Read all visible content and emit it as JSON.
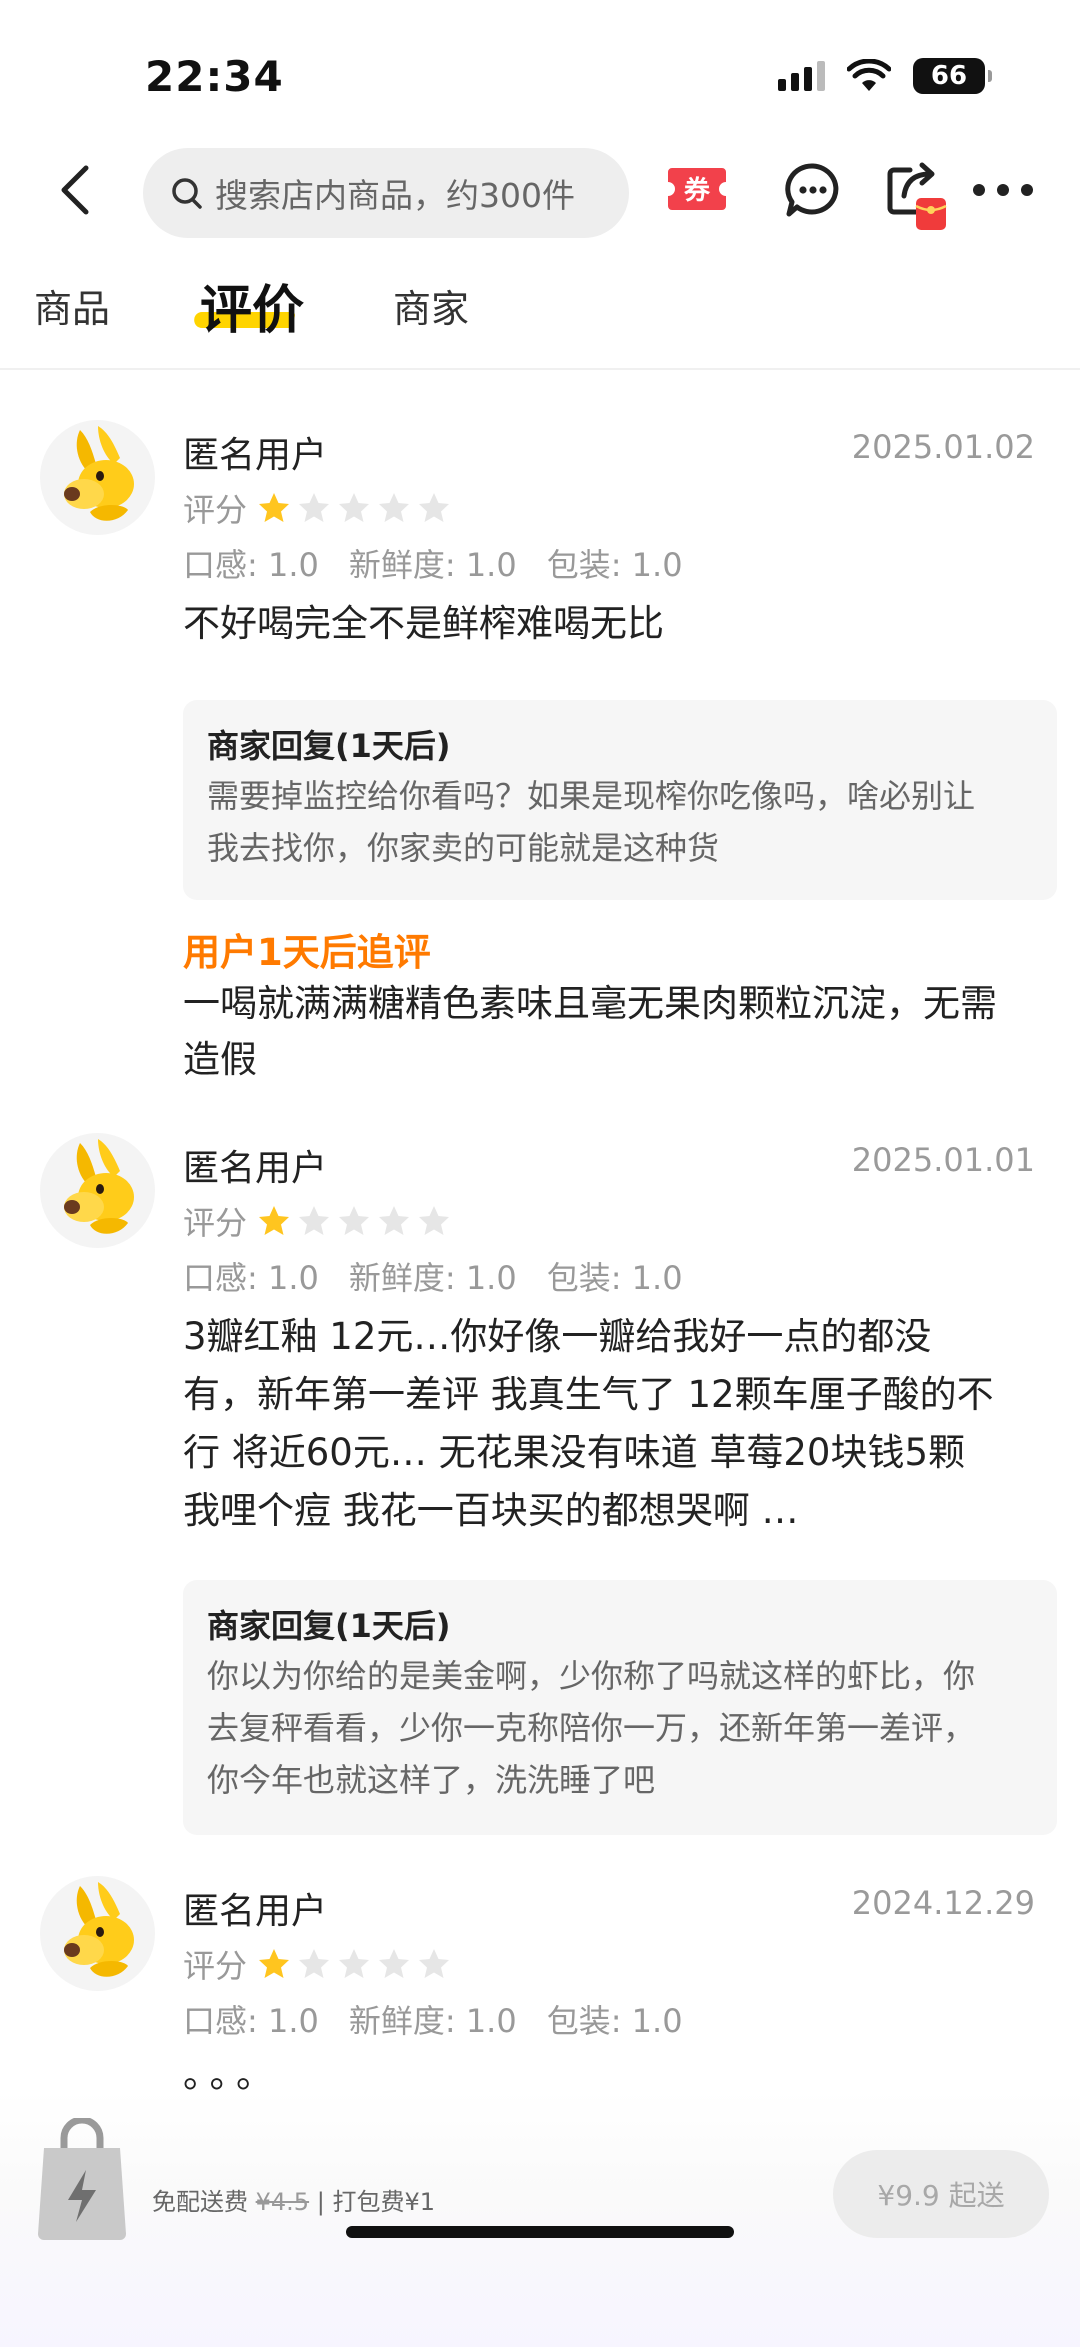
{
  "status_bar": {
    "time": "22:34",
    "battery": "66"
  },
  "header": {
    "search_placeholder": "搜索店内商品，约300件",
    "coupon_label": "券"
  },
  "tabs": [
    {
      "label": "商品",
      "active": false
    },
    {
      "label": "评价",
      "active": true
    },
    {
      "label": "商家",
      "active": false
    }
  ],
  "reviews": [
    {
      "user": "匿名用户",
      "date": "2025.01.02",
      "rating_label": "评分",
      "stars": 1,
      "scores": [
        "口感: 1.0",
        "新鲜度: 1.0",
        "包装: 1.0"
      ],
      "text": "不好喝完全不是鲜榨难喝无比",
      "reply_title": "商家回复(1天后)",
      "reply_lines": [
        "需要掉监控给你看吗？如果是现榨你吃像吗，啥必别让",
        "我去找你，你家卖的可能就是这种货"
      ],
      "followup_label": "用户1天后追评",
      "followup_lines": [
        "一喝就满满糖精色素味且毫无果肉颗粒沉淀，无需",
        "造假"
      ]
    },
    {
      "user": "匿名用户",
      "date": "2025.01.01",
      "rating_label": "评分",
      "stars": 1,
      "scores": [
        "口感: 1.0",
        "新鲜度: 1.0",
        "包装: 1.0"
      ],
      "text_lines": [
        "3瓣红釉 12元…你好像一瓣给我好一点的都没",
        "有，新年第一差评 我真生气了 12颗车厘子酸的不",
        "行 将近60元… 无花果没有味道 草莓20块钱5颗",
        "我哩个痘 我花一百块买的都想哭啊 …"
      ],
      "reply_title": "商家回复(1天后)",
      "reply_lines": [
        "你以为你给的是美金啊，少你称了吗就这样的虾比，你",
        "去复秤看看，少你一克称陪你一万，还新年第一差评，",
        "你今年也就这样了，洗洗睡了吧"
      ]
    },
    {
      "user": "匿名用户",
      "date": "2024.12.29",
      "rating_label": "评分",
      "stars": 1,
      "scores": [
        "口感: 1.0",
        "新鲜度: 1.0",
        "包装: 1.0"
      ],
      "text": "。。。"
    }
  ],
  "bottom_bar": {
    "delivery_free": "免配送费",
    "delivery_original": "¥4.5",
    "separator": "|",
    "packing_fee": "打包费¥1",
    "min_order_button": "¥9.9 起送"
  },
  "colors": {
    "accent_yellow": "#ffd400",
    "followup_orange": "#ff7a00",
    "coupon_red": "#f2414b",
    "star_filled": "#ffc51f",
    "star_empty": "#e6e6e6"
  }
}
